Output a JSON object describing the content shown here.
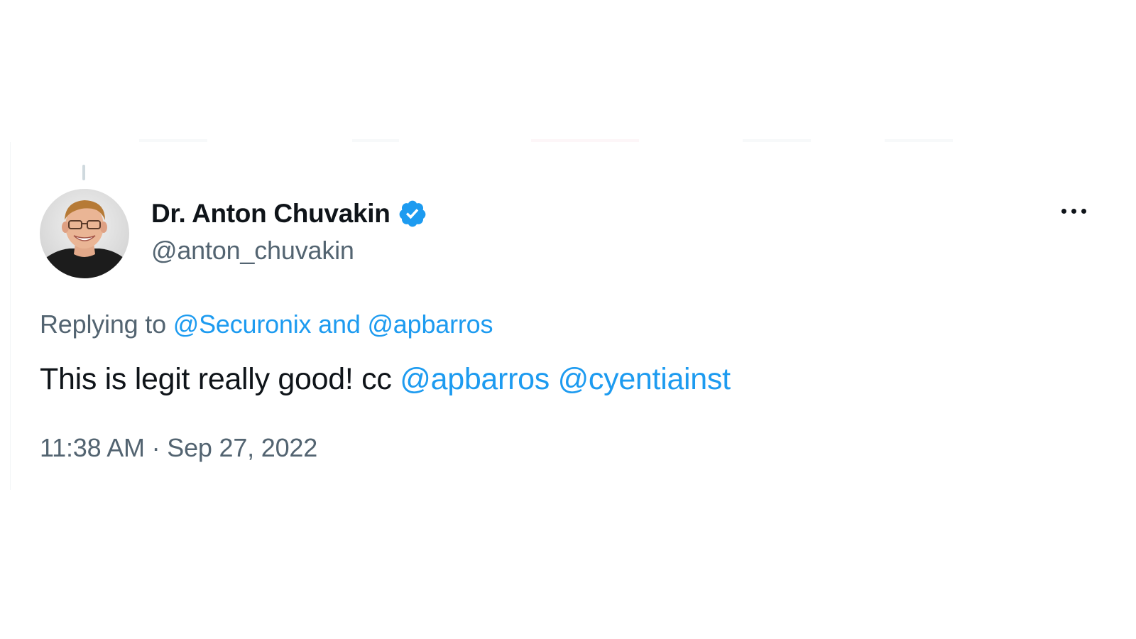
{
  "author": {
    "display_name": "Dr. Anton Chuvakin",
    "handle": "@anton_chuvakin",
    "verified": true
  },
  "reply": {
    "prefix": "Replying to",
    "mention_1": "@Securonix",
    "conjunction": "and",
    "mention_2": "@apbarros"
  },
  "tweet": {
    "text_plain": "This is legit really good! cc",
    "mention_1": "@apbarros",
    "mention_2": "@cyentiainst"
  },
  "meta": {
    "time": "11:38 AM",
    "separator": "·",
    "date": "Sep 27, 2022"
  },
  "icons": {
    "verified": "verified-badge-icon",
    "more": "more-options-icon"
  },
  "colors": {
    "link": "#1d9bf0",
    "primary_text": "#0f1419",
    "secondary_text": "#536471",
    "verified_badge": "#1d9bf0"
  }
}
